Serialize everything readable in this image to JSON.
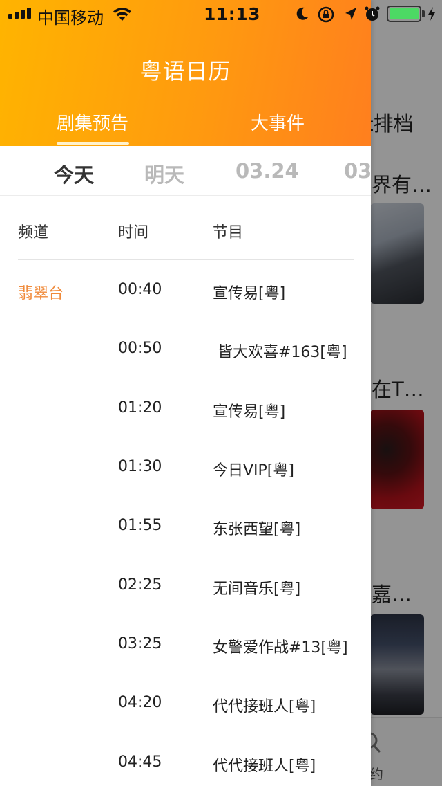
{
  "status_bar": {
    "carrier": "中国移动",
    "time": "11:13",
    "battery_color": "#4cd964"
  },
  "background_app": {
    "header_tab_fragment": "排档",
    "header_tab_fragment_prefix": "t",
    "item_titles": [
      "界有…",
      "在T…",
      "嘉…"
    ],
    "tabbar_fragment": "约"
  },
  "drawer": {
    "title": "粤语日历",
    "tabs": [
      {
        "label": "剧集预告",
        "active": true
      },
      {
        "label": "大事件",
        "active": false
      }
    ],
    "days": [
      {
        "label": "今天",
        "active": true
      },
      {
        "label": "明天",
        "active": false
      },
      {
        "label": "03.24",
        "active": false
      },
      {
        "label": "03",
        "active": false
      }
    ],
    "table": {
      "headers": {
        "channel": "频道",
        "time": "时间",
        "program": "节目"
      },
      "rows": [
        {
          "channel": "翡翠台",
          "time": "00:40",
          "program": "宣传易[粤]"
        },
        {
          "channel": "",
          "time": "00:50",
          "program": " 皆大欢喜#163[粤]"
        },
        {
          "channel": "",
          "time": "01:20",
          "program": "宣传易[粤]"
        },
        {
          "channel": "",
          "time": "01:30",
          "program": "今日VIP[粤]"
        },
        {
          "channel": "",
          "time": "01:55",
          "program": "东张西望[粤]"
        },
        {
          "channel": "",
          "time": "02:25",
          "program": "无间音乐[粤]"
        },
        {
          "channel": "",
          "time": "03:25",
          "program": "女警爱作战#13[粤]"
        },
        {
          "channel": "",
          "time": "04:20",
          "program": "代代接班人[粤]"
        },
        {
          "channel": "",
          "time": "04:45",
          "program": "代代接班人[粤]"
        }
      ]
    },
    "colors": {
      "header_gradient_start": "#ffb400",
      "header_gradient_end": "#ff7f1e",
      "channel_accent": "#f08a3a"
    }
  }
}
